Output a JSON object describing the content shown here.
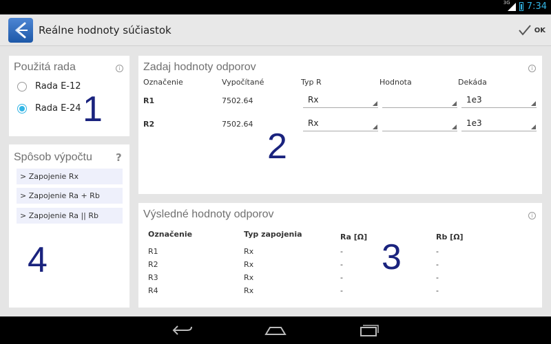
{
  "status_bar": {
    "network": "3G",
    "time": "7:34"
  },
  "action_bar": {
    "title": "Reálne hodnoty súčiastok",
    "ok_label": "OK",
    "app_icon": "back-chevron-app-icon",
    "ok_icon": "checkmark-icon"
  },
  "series_card": {
    "title": "Použitá rada",
    "options": [
      {
        "label": "Rada E-12",
        "selected": false
      },
      {
        "label": "Rada E-24",
        "selected": true
      }
    ],
    "annotation": "1"
  },
  "method_card": {
    "title": "Spôsob výpočtu",
    "help_icon": "?",
    "buttons": [
      "> Zapojenie Rx",
      "> Zapojenie Ra + Rb",
      "> Zapojenie Ra || Rb"
    ],
    "annotation": "4"
  },
  "input_card": {
    "title": "Zadaj hodnoty odporov",
    "headers": [
      "Označenie",
      "Vypočítané",
      "Typ R",
      "Hodnota",
      "Dekáda"
    ],
    "rows": [
      {
        "label": "R1",
        "computed": "7502.64",
        "type": "Rx",
        "value": "",
        "decade": "1e3"
      },
      {
        "label": "R2",
        "computed": "7502.64",
        "type": "Rx",
        "value": "",
        "decade": "1e3"
      }
    ],
    "annotation": "2"
  },
  "result_card": {
    "title": "Výsledné hodnoty odporov",
    "headers": [
      "Označenie",
      "Typ zapojenia",
      "Ra [Ω]",
      "Rb [Ω]"
    ],
    "rows": [
      {
        "label": "R1",
        "type": "Rx",
        "ra": "-",
        "rb": "-"
      },
      {
        "label": "R2",
        "type": "Rx",
        "ra": "-",
        "rb": "-"
      },
      {
        "label": "R3",
        "type": "Rx",
        "ra": "-",
        "rb": "-"
      },
      {
        "label": "R4",
        "type": "Rx",
        "ra": "-",
        "rb": "-"
      }
    ],
    "annotation": "3"
  },
  "colors": {
    "accent": "#33b5e5",
    "annotation": "#1a237e",
    "card": "#ffffff",
    "background": "#e5e5e5"
  }
}
